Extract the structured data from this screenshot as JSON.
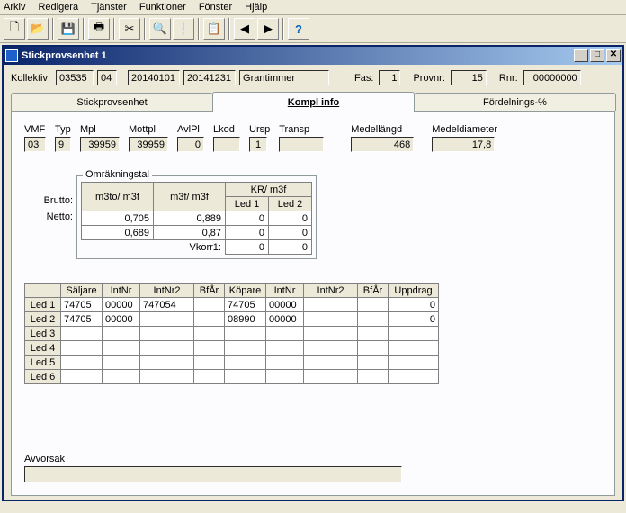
{
  "menu": {
    "arkiv": "Arkiv",
    "redigera": "Redigera",
    "tjanster": "Tjänster",
    "funktioner": "Funktioner",
    "fonster": "Fönster",
    "hjalp": "Hjälp"
  },
  "window": {
    "title": "Stickprovsenhet 1"
  },
  "top": {
    "kollektiv_lbl": "Kollektiv:",
    "kollektiv1": "03535",
    "kollektiv2": "04",
    "date1": "20140101",
    "date2": "20141231",
    "kind": "Grantimmer",
    "fas_lbl": "Fas:",
    "fas": "1",
    "provnr_lbl": "Provnr:",
    "provnr": "15",
    "rnr_lbl": "Rnr:",
    "rnr": "00000000"
  },
  "tabs": {
    "t1": "Stickprovsenhet",
    "t2": "Kompl info",
    "t3": "Fördelnings-%"
  },
  "hdr": {
    "vmf_lbl": "VMF",
    "vmf": "03",
    "typ_lbl": "Typ",
    "typ": "9",
    "mpl_lbl": "Mpl",
    "mpl": "39959",
    "mottpl_lbl": "Mottpl",
    "mottpl": "39959",
    "avlpl_lbl": "AvlPl",
    "avlpl": "0",
    "lkod_lbl": "Lkod",
    "lkod": "",
    "ursp_lbl": "Ursp",
    "ursp": "1",
    "transp_lbl": "Transp",
    "transp": "",
    "medell_lbl": "Medellängd",
    "medell": "468",
    "medeld_lbl": "Medeldiameter",
    "medeld": "17,8"
  },
  "omr": {
    "title": "Omräkningstal",
    "c1": "m3to/ m3f",
    "c2": "m3f/ m3f",
    "c3": "KR/ m3f",
    "c3a": "Led 1",
    "c3b": "Led 2",
    "brutto_lbl": "Brutto:",
    "netto_lbl": "Netto:",
    "vkorr_lbl": "Vkorr1:",
    "brutto": {
      "m3to": "0,705",
      "m3f": "0,889",
      "l1": "0",
      "l2": "0"
    },
    "netto": {
      "m3to": "0,689",
      "m3f": "0,87",
      "l1": "0",
      "l2": "0"
    },
    "vkorr": {
      "l1": "0",
      "l2": "0"
    }
  },
  "led": {
    "headers": {
      "h0": "",
      "h1": "Säljare",
      "h2": "IntNr",
      "h3": "IntNr2",
      "h4": "BfÅr",
      "h5": "Köpare",
      "h6": "IntNr",
      "h7": "IntNr2",
      "h8": "BfÅr",
      "h9": "Uppdrag"
    },
    "rows": [
      {
        "name": "Led 1",
        "saljare": "74705",
        "intnr": "00000",
        "intnr2": "747054",
        "bfar": "",
        "kopare": "74705",
        "kintnr": "00000",
        "kintnr2": "",
        "kbfar": "",
        "uppdrag": "0"
      },
      {
        "name": "Led 2",
        "saljare": "74705",
        "intnr": "00000",
        "intnr2": "",
        "bfar": "",
        "kopare": "08990",
        "kintnr": "00000",
        "kintnr2": "",
        "kbfar": "",
        "uppdrag": "0"
      },
      {
        "name": "Led 3",
        "saljare": "",
        "intnr": "",
        "intnr2": "",
        "bfar": "",
        "kopare": "",
        "kintnr": "",
        "kintnr2": "",
        "kbfar": "",
        "uppdrag": ""
      },
      {
        "name": "Led 4",
        "saljare": "",
        "intnr": "",
        "intnr2": "",
        "bfar": "",
        "kopare": "",
        "kintnr": "",
        "kintnr2": "",
        "kbfar": "",
        "uppdrag": ""
      },
      {
        "name": "Led 5",
        "saljare": "",
        "intnr": "",
        "intnr2": "",
        "bfar": "",
        "kopare": "",
        "kintnr": "",
        "kintnr2": "",
        "kbfar": "",
        "uppdrag": ""
      },
      {
        "name": "Led 6",
        "saljare": "",
        "intnr": "",
        "intnr2": "",
        "bfar": "",
        "kopare": "",
        "kintnr": "",
        "kintnr2": "",
        "kbfar": "",
        "uppdrag": ""
      }
    ]
  },
  "avv": {
    "label": "Avvorsak",
    "value": ""
  }
}
